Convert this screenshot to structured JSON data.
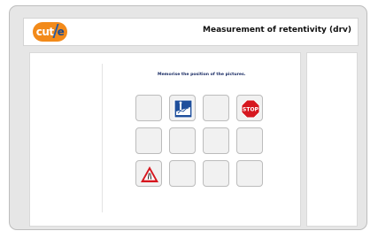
{
  "header": {
    "logo_text": "cut",
    "logo_suffix": "e",
    "title": "Measurement of retentivity (drv)"
  },
  "test": {
    "instruction": "Memorise the position of the pictures."
  },
  "grid": {
    "rows": 3,
    "columns": 4,
    "tiles": [
      {
        "row": 1,
        "col": 1,
        "icon": null
      },
      {
        "row": 1,
        "col": 2,
        "icon": "uphill-gradient-sign-icon"
      },
      {
        "row": 1,
        "col": 3,
        "icon": null
      },
      {
        "row": 1,
        "col": 4,
        "icon": "stop-sign-icon"
      },
      {
        "row": 2,
        "col": 1,
        "icon": null
      },
      {
        "row": 2,
        "col": 2,
        "icon": null
      },
      {
        "row": 2,
        "col": 3,
        "icon": null
      },
      {
        "row": 2,
        "col": 4,
        "icon": null
      },
      {
        "row": 3,
        "col": 1,
        "icon": "warning-triangle-sign-icon"
      },
      {
        "row": 3,
        "col": 2,
        "icon": null
      },
      {
        "row": 3,
        "col": 3,
        "icon": null
      },
      {
        "row": 3,
        "col": 4,
        "icon": null
      }
    ],
    "stop_text": "STOP"
  },
  "colors": {
    "logo_orange": "#f28a1a",
    "logo_blue": "#1b4a8e",
    "instruction_text": "#1a2c64",
    "stop_red": "#d6171f",
    "sign_blue": "#1f4f9c"
  }
}
